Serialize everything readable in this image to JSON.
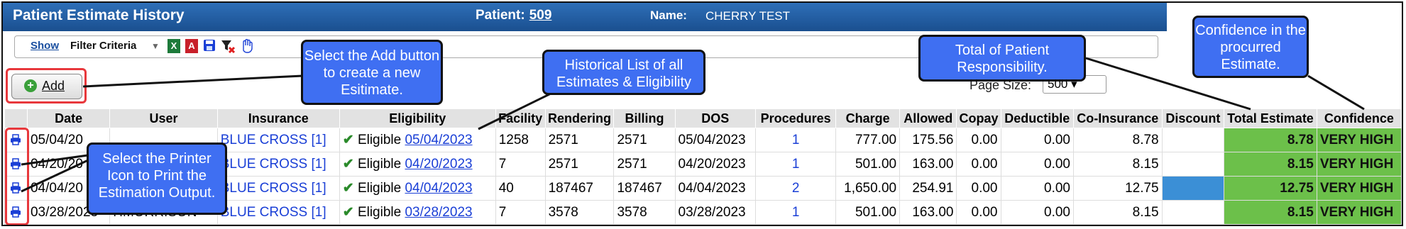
{
  "window": {
    "title": "Patient Estimate History",
    "patient_label": "Patient:",
    "patient_number": "509",
    "name_label": "Name:",
    "name_value": "CHERRY TEST"
  },
  "toolbar": {
    "show_label": "Show",
    "filter_label": "Filter Criteria",
    "icons": [
      "excel-icon",
      "pdf-icon",
      "save-icon",
      "clear-filter-icon",
      "hand-icon"
    ]
  },
  "add_button": {
    "label": "Add"
  },
  "page_size": {
    "label": "Page Size:",
    "value": "500"
  },
  "table": {
    "headers": [
      "",
      "Date",
      "User",
      "Insurance",
      "Eligibility",
      "Facility",
      "Rendering",
      "Billing",
      "DOS",
      "Procedures",
      "Charge",
      "Allowed",
      "Copay",
      "Deductible",
      "Co-Insurance",
      "Discount",
      "Total Estimate",
      "Confidence"
    ],
    "rows": [
      {
        "date": "05/04/20",
        "user": "",
        "insurance": "BLUE CROSS [1]",
        "elig_status": "Eligible",
        "elig_date": "05/04/2023",
        "facility": "1258",
        "rendering": "2571",
        "billing": "2571",
        "dos": "05/04/2023",
        "procedures": "1",
        "charge": "777.00",
        "allowed": "175.56",
        "copay": "0.00",
        "deductible": "0.00",
        "coins": "8.78",
        "discount": "",
        "total": "8.78",
        "confidence": "VERY HIGH"
      },
      {
        "date": "04/20/20",
        "user": "",
        "insurance": "BLUE CROSS [1]",
        "elig_status": "Eligible",
        "elig_date": "04/20/2023",
        "facility": "7",
        "rendering": "2571",
        "billing": "2571",
        "dos": "04/20/2023",
        "procedures": "1",
        "charge": "501.00",
        "allowed": "163.00",
        "copay": "0.00",
        "deductible": "0.00",
        "coins": "8.15",
        "discount": "",
        "total": "8.15",
        "confidence": "VERY HIGH"
      },
      {
        "date": "04/04/20",
        "user": "",
        "insurance": "BLUE CROSS [1]",
        "elig_status": "Eligible",
        "elig_date": "04/04/2023",
        "facility": "40",
        "rendering": "187467",
        "billing": "187467",
        "dos": "04/04/2023",
        "procedures": "2",
        "charge": "1,650.00",
        "allowed": "254.91",
        "copay": "0.00",
        "deductible": "0.00",
        "coins": "12.75",
        "discount": "",
        "total": "12.75",
        "confidence": "VERY HIGH"
      },
      {
        "date": "03/28/2023",
        "user": "HMORRISON",
        "insurance": "BLUE CROSS [1]",
        "elig_status": "Eligible",
        "elig_date": "03/28/2023",
        "facility": "7",
        "rendering": "3578",
        "billing": "3578",
        "dos": "03/28/2023",
        "procedures": "1",
        "charge": "501.00",
        "allowed": "163.00",
        "copay": "0.00",
        "deductible": "0.00",
        "coins": "8.15",
        "discount": "",
        "total": "8.15",
        "confidence": "VERY HIGH"
      }
    ]
  },
  "callouts": {
    "add": "Select the Add button to create a new Esitimate.",
    "history": "Historical List of all Estimates & Eligibility",
    "total": "Total of Patient Responsibility.",
    "confidence": "Confidence in the procurred Estimate.",
    "printer": "Select the Printer Icon to Print the Estimation Output."
  },
  "colors": {
    "title_bar": "#1a4f8f",
    "callout": "#3f6ff2",
    "estimate_green": "#6cc04a",
    "discount_blue": "#3b8fd6",
    "highlight_red": "#e8383c"
  }
}
